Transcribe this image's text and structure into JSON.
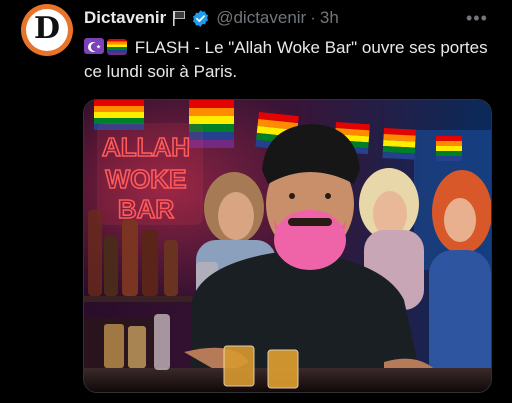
{
  "tweet": {
    "display_name": "Dictavenir",
    "handle": "@dictavenir",
    "separator": "·",
    "time": "3h",
    "more_label": "•••",
    "text": "FLASH - Le \"Allah Woke Bar\" ouvre ses portes ce lundi soir à Paris.",
    "emojis": [
      "moon-star-icon",
      "rainbow-flag-icon"
    ]
  },
  "avatar": {
    "letter": "D",
    "ring_color": "#e8732a"
  },
  "media": {
    "neon_sign_lines": [
      "ALLAH",
      "WOKE",
      "BAR"
    ],
    "neon_color": "#ff4f4f"
  },
  "colors": {
    "background": "#000000",
    "text": "#e7e9ea",
    "muted": "#71767b",
    "verified": "#1d9bf0"
  }
}
